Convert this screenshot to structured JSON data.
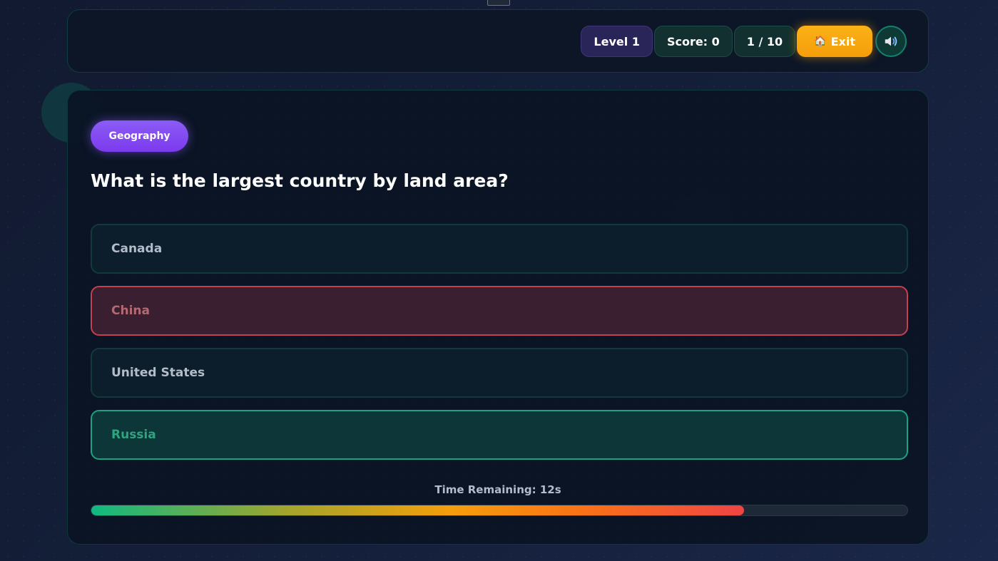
{
  "header": {
    "level_label": "Level 1",
    "score_label": "Score: 0",
    "progress_label": "1 / 10",
    "exit_icon": "🏠",
    "exit_label": "Exit",
    "sound_icon": "speaker-icon"
  },
  "question": {
    "category": "Geography",
    "text": "What is the largest country by land area?",
    "answers": [
      {
        "label": "Canada",
        "state": "neutral"
      },
      {
        "label": "China",
        "state": "wrong"
      },
      {
        "label": "United States",
        "state": "neutral"
      },
      {
        "label": "Russia",
        "state": "correct"
      }
    ]
  },
  "timer": {
    "label": "Time Remaining: 12s",
    "fraction_remaining": 0.8
  },
  "colors": {
    "accent_purple": "#8b5cf6",
    "exit_orange": "#f59e0b",
    "correct_green": "#18a382",
    "wrong_red": "#c2414e",
    "teal_border": "#14806f"
  }
}
